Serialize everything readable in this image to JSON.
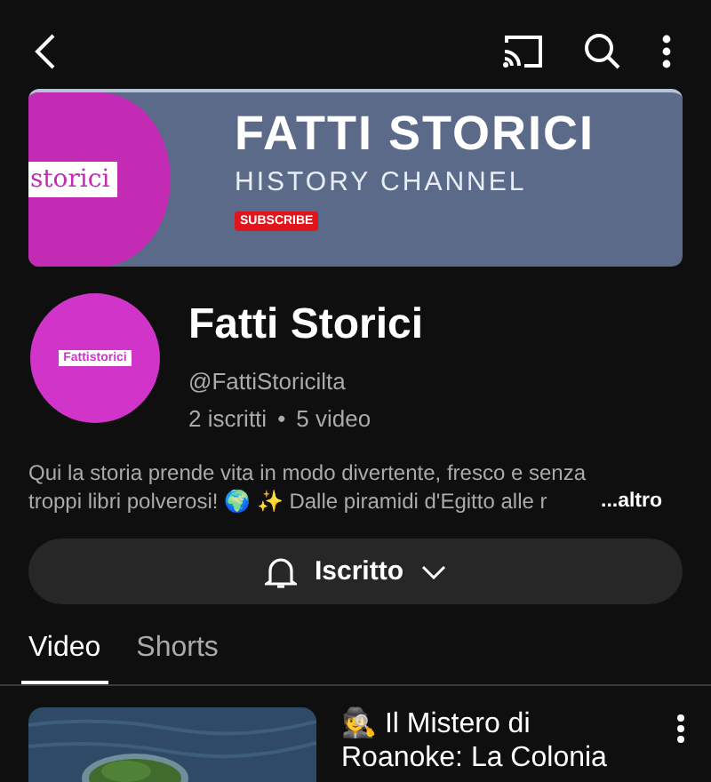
{
  "banner": {
    "logo_text": "storici",
    "title": "FATTI STORICI",
    "subtitle": "HISTORY CHANNEL",
    "badge": "SUBSCRIBE"
  },
  "channel": {
    "avatar_text": "Fattistorici",
    "name": "Fatti Storici",
    "handle": "@FattiStoricilta",
    "subscribers": "2 iscritti",
    "separator": "•",
    "videos": "5 video"
  },
  "description": {
    "text": "Qui la storia prende vita in modo divertente, fresco e senza troppi libri polverosi! 🌍 ✨ Dalle piramidi d'Egitto alle r",
    "more": "...altro"
  },
  "subscribe_button": {
    "label": "Iscritto"
  },
  "tabs": [
    {
      "label": "Video",
      "selected": true
    },
    {
      "label": "Shorts",
      "selected": false
    }
  ],
  "videos": [
    {
      "title": "🕵️ Il Mistero di Roanoke: La Colonia"
    }
  ]
}
